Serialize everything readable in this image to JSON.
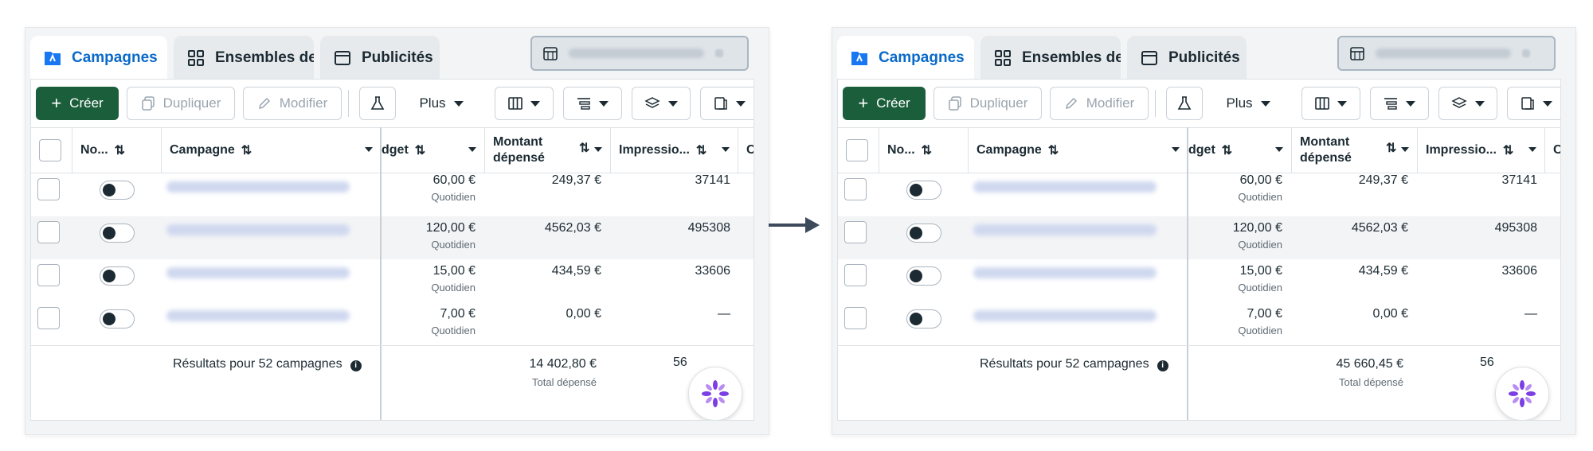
{
  "tabs": [
    {
      "label": "Campagnes",
      "icon": "campaign-folder-icon"
    },
    {
      "label": "Ensembles de",
      "icon": "grid-icon"
    },
    {
      "label": "Publicités",
      "icon": "ad-window-icon"
    }
  ],
  "toolbar": {
    "create_label": "Créer",
    "duplicate_label": "Dupliquer",
    "edit_label": "Modifier",
    "more_label": "Plus"
  },
  "table": {
    "headers": {
      "name": "No...",
      "campaign": "Campagne",
      "budget": "dget",
      "spent": "Montant dépensé",
      "impressions": "Impressio...",
      "next": "C"
    },
    "rows": [
      {
        "budget": "60,00 €",
        "budget_period": "Quotidien",
        "spent": "249,37 €",
        "impressions": "37141"
      },
      {
        "budget": "120,00 €",
        "budget_period": "Quotidien",
        "spent": "4562,03 €",
        "impressions": "495308"
      },
      {
        "budget": "15,00 €",
        "budget_period": "Quotidien",
        "spent": "434,59 €",
        "impressions": "33606"
      },
      {
        "budget": "7,00 €",
        "budget_period": "Quotidien",
        "spent": "0,00 €",
        "impressions": "—"
      }
    ]
  },
  "summary": {
    "label": "Résultats pour 52 campagnes",
    "left_total": "14 402,80 €",
    "right_total": "45 660,45 €",
    "total_label": "Total dépensé",
    "impressions_partial": "56"
  },
  "colors": {
    "accent_blue": "#0a6ac9",
    "create_green": "#1b5e3b",
    "arrow": "#3d4a5c",
    "ai_purple": "#7b3fe4"
  }
}
